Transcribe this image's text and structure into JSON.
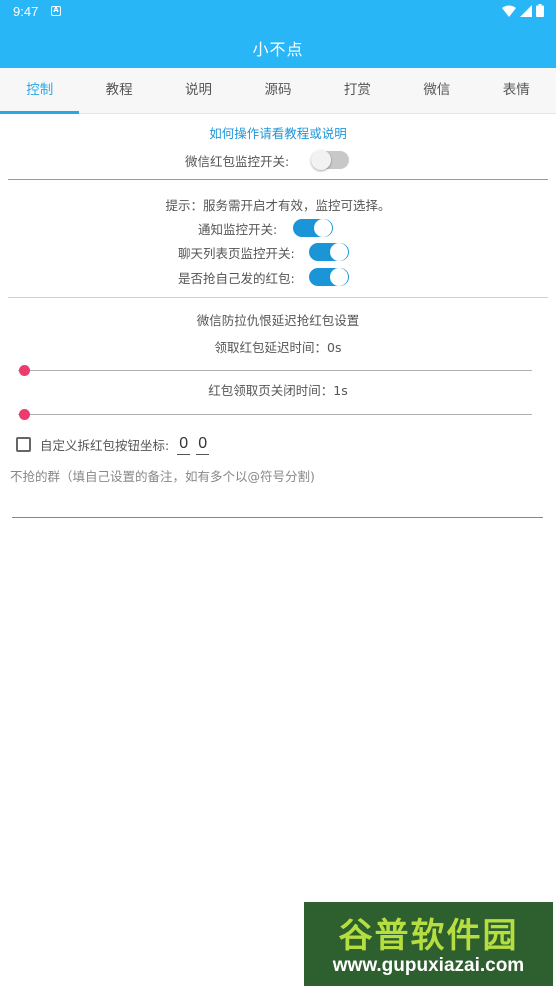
{
  "status_bar": {
    "time": "9:47",
    "notification": "A"
  },
  "appbar": {
    "title": "小不点"
  },
  "tabs": [
    {
      "label": "控制"
    },
    {
      "label": "教程"
    },
    {
      "label": "说明"
    },
    {
      "label": "源码"
    },
    {
      "label": "打赏"
    },
    {
      "label": "微信"
    },
    {
      "label": "表情"
    }
  ],
  "active_tab": "控制",
  "help_link": "如何操作请看教程或说明",
  "wechat_monitor": {
    "label": "微信红包监控开关:",
    "on": false
  },
  "tip": "提示：服务需开启才有效，监控可选择。",
  "notify_monitor": {
    "label": "通知监控开关:",
    "on": true
  },
  "chatlist_monitor": {
    "label": "聊天列表页监控开关:",
    "on": true
  },
  "grab_own": {
    "label": "是否抢自己发的红包:",
    "on": true
  },
  "delay_section_title": "微信防拉仇恨延迟抢红包设置",
  "grab_delay": {
    "label": "领取红包延迟时间：0s",
    "value": 0
  },
  "close_delay": {
    "label": "红包领取页关闭时间：1s",
    "value": 0
  },
  "custom_coords": {
    "label": "自定义拆红包按钮坐标:",
    "checked": false,
    "x": "0",
    "y": "0"
  },
  "exclude_groups_hint": "不抢的群（填自己设置的备注，如有多个以@符号分割)",
  "watermark": {
    "big": "谷普软件园",
    "small": "www.gupuxiazai.com"
  },
  "colors": {
    "primary": "#29b6f6",
    "accent": "#1a96d8",
    "slider_thumb": "#ee3b6e"
  }
}
